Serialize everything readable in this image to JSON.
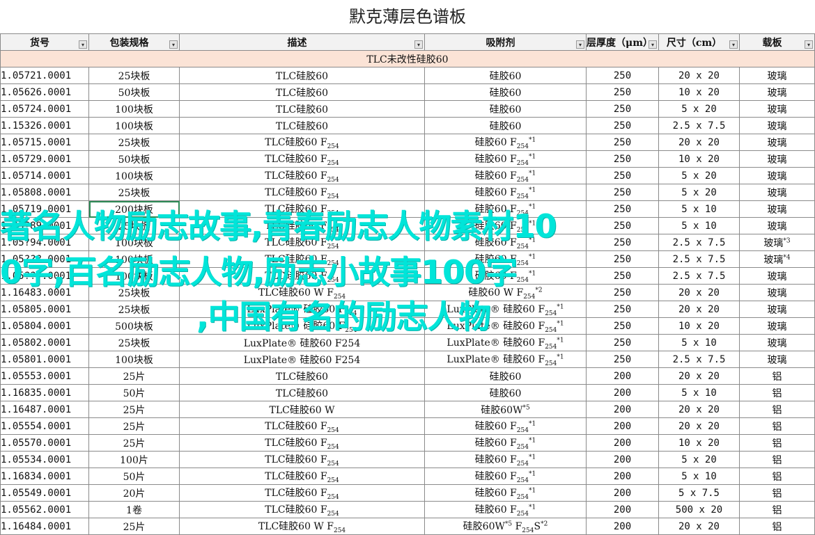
{
  "title": "默克薄层色谱板",
  "headers": [
    "货号",
    "包装规格",
    "描述",
    "吸附剂",
    "层厚度（μm）",
    "尺寸（cm）",
    "载板"
  ],
  "section_label": "TLC未改性硅胶60",
  "rows": [
    {
      "id": "1.05721.0001",
      "pack": "25块板",
      "desc": "TLC硅胶60",
      "ads": "硅胶60",
      "thick": "250",
      "size": "20 x 20",
      "plate": "玻璃"
    },
    {
      "id": "1.05626.0001",
      "pack": "50块板",
      "desc": "TLC硅胶60",
      "ads": "硅胶60",
      "thick": "250",
      "size": "10 x 20",
      "plate": "玻璃"
    },
    {
      "id": "1.05724.0001",
      "pack": "100块板",
      "desc": "TLC硅胶60",
      "ads": "硅胶60",
      "thick": "250",
      "size": "5 x 20",
      "plate": "玻璃"
    },
    {
      "id": "1.15326.0001",
      "pack": "100块板",
      "desc": "TLC硅胶60",
      "ads": "硅胶60",
      "thick": "250",
      "size": "2.5 x 7.5",
      "plate": "玻璃"
    },
    {
      "id": "1.05715.0001",
      "pack": "25块板",
      "desc": "TLC硅胶60 F",
      "desc_sub": "254",
      "ads": "硅胶60 F",
      "ads_sub": "254",
      "ads_sup": "*1",
      "thick": "250",
      "size": "20 x 20",
      "plate": "玻璃"
    },
    {
      "id": "1.05729.0001",
      "pack": "50块板",
      "desc": "TLC硅胶60 F",
      "desc_sub": "254",
      "ads": "硅胶60 F",
      "ads_sub": "254",
      "ads_sup": "*1",
      "thick": "250",
      "size": "10 x 20",
      "plate": "玻璃"
    },
    {
      "id": "1.05714.0001",
      "pack": "100块板",
      "desc": "TLC硅胶60 F",
      "desc_sub": "254",
      "ads": "硅胶60 F",
      "ads_sub": "254",
      "ads_sup": "*1",
      "thick": "250",
      "size": "5 x 20",
      "plate": "玻璃"
    },
    {
      "id": "1.05808.0001",
      "pack": "25块板",
      "desc": "TLC硅胶60 F",
      "desc_sub": "254",
      "ads": "硅胶60 F",
      "ads_sub": "254",
      "ads_sup": "*1",
      "thick": "250",
      "size": "5 x 20",
      "plate": "玻璃"
    },
    {
      "id": "1.05719.0001",
      "pack": "200块板",
      "desc": "TLC硅胶60 F",
      "desc_sub": "254",
      "ads": "硅胶60 F",
      "ads_sub": "254",
      "ads_sup": "*1",
      "thick": "250",
      "size": "5 x 10",
      "plate": "玻璃"
    },
    {
      "id": "1.05?89.0001",
      "pack": "25块板",
      "desc": "TLC硅胶60 F",
      "desc_sub": "254",
      "ads": "硅胶60 F",
      "ads_sub": "254",
      "ads_sup": "*1",
      "thick": "250",
      "size": "5 x 10",
      "plate": "玻璃"
    },
    {
      "id": "1.05?94.0001",
      "pack": "100块板",
      "desc": "TLC硅胶60 F",
      "desc_sub": "254",
      "ads": "硅胶60 F",
      "ads_sub": "254",
      "ads_sup": "*1",
      "thick": "250",
      "size": "2.5 x 7.5",
      "plate": "玻璃",
      "plate_sup": "*3"
    },
    {
      "id": "1.05???.0001",
      "pack": "100块板",
      "desc": "TLC硅胶60 F",
      "desc_sub": "254",
      "ads": "硅胶60 F",
      "ads_sub": "254",
      "ads_sup": "*1",
      "thick": "250",
      "size": "2.5 x 7.5",
      "plate": "玻璃",
      "plate_sup": "*4"
    },
    {
      "id": "1.05???.0001",
      "pack": "100块板",
      "desc": "TLC硅胶60 F",
      "desc_sub": "254",
      "ads": "硅胶60 F",
      "ads_sub": "254",
      "ads_sup": "*1",
      "thick": "250",
      "size": "2.5 x 7.5",
      "plate": "玻璃"
    },
    {
      "id": "1.16483.0001",
      "pack": "25块板",
      "desc": "TLC硅胶60 W F",
      "desc_sub": "254",
      "ads": "硅胶60 W F",
      "ads_sub": "254",
      "ads_sup": "*2",
      "thick": "250",
      "size": "20 x 20",
      "plate": "玻璃"
    },
    {
      "id": "1.05805.0001",
      "pack": "25块板",
      "desc": "LuxPlate® 硅胶60 F",
      "desc_sub": "254",
      "ads": "LuxPlate® 硅胶60 F",
      "ads_sub": "254",
      "ads_sup": "*1",
      "thick": "250",
      "size": "20 x 20",
      "plate": "玻璃"
    },
    {
      "id": "1.05804.0001",
      "pack": "500块板",
      "desc": "LuxPlate® 硅胶60 F",
      "desc_sub": "254",
      "ads": "LuxPlate® 硅胶60 F",
      "ads_sub": "254",
      "ads_sup": "*1",
      "thick": "250",
      "size": "10 x 20",
      "plate": "玻璃"
    },
    {
      "id": "1.05802.0001",
      "pack": "25块板",
      "desc": "LuxPlate® 硅胶60 F254",
      "ads": "LuxPlate® 硅胶60 F",
      "ads_sub": "254",
      "ads_sup": "*1",
      "thick": "250",
      "size": "5 x 10",
      "plate": "玻璃"
    },
    {
      "id": "1.05801.0001",
      "pack": "100块板",
      "desc": "LuxPlate® 硅胶60 F254",
      "ads": "LuxPlate® 硅胶60 F",
      "ads_sub": "254",
      "ads_sup": "*1",
      "thick": "250",
      "size": "2.5 x 7.5",
      "plate": "玻璃"
    },
    {
      "id": "1.05553.0001",
      "pack": "25片",
      "desc": "TLC硅胶60",
      "ads": "硅胶60",
      "thick": "200",
      "size": "20 x 20",
      "plate": "铝"
    },
    {
      "id": "1.16835.0001",
      "pack": "50片",
      "desc": "TLC硅胶60",
      "ads": "硅胶60",
      "thick": "200",
      "size": "5 x 10",
      "plate": "铝"
    },
    {
      "id": "1.16487.0001",
      "pack": "25片",
      "desc": "TLC硅胶60 W",
      "ads": "硅胶60W",
      "ads_sup": "*5",
      "thick": "200",
      "size": "20 x 20",
      "plate": "铝"
    },
    {
      "id": "1.05554.0001",
      "pack": "25片",
      "desc": "TLC硅胶60 F",
      "desc_sub": "254",
      "ads": "硅胶60 F",
      "ads_sub": "254",
      "ads_sup": "*1",
      "thick": "200",
      "size": "20 x 20",
      "plate": "铝"
    },
    {
      "id": "1.05570.0001",
      "pack": "25片",
      "desc": "TLC硅胶60 F",
      "desc_sub": "254",
      "ads": "硅胶60 F",
      "ads_sub": "254",
      "ads_sup": "*1",
      "thick": "200",
      "size": "10 x 20",
      "plate": "铝"
    },
    {
      "id": "1.05534.0001",
      "pack": "100片",
      "desc": "TLC硅胶60 F",
      "desc_sub": "254",
      "ads": "硅胶60 F",
      "ads_sub": "254",
      "ads_sup": "*1",
      "thick": "200",
      "size": "5 x 20",
      "plate": "铝"
    },
    {
      "id": "1.16834.0001",
      "pack": "50片",
      "desc": "TLC硅胶60 F",
      "desc_sub": "254",
      "ads": "硅胶60 F",
      "ads_sub": "254",
      "ads_sup": "*1",
      "thick": "200",
      "size": "5 x 10",
      "plate": "铝"
    },
    {
      "id": "1.05549.0001",
      "pack": "20片",
      "desc": "TLC硅胶60 F",
      "desc_sub": "254",
      "ads": "硅胶60 F",
      "ads_sub": "254",
      "ads_sup": "*1",
      "thick": "200",
      "size": "5 x 7.5",
      "plate": "铝"
    },
    {
      "id": "1.05562.0001",
      "pack": "1卷",
      "desc": "TLC硅胶60 F",
      "desc_sub": "254",
      "ads": "硅胶60 F",
      "ads_sub": "254",
      "ads_sup": "*1",
      "thick": "200",
      "size": "500 x 20",
      "plate": "铝"
    },
    {
      "id": "1.16484.0001",
      "pack": "25片",
      "desc": "TLC硅胶60 W F",
      "desc_sub": "254",
      "ads": "硅胶60W",
      "ads_sup": "*5",
      "ads2": " F",
      "ads2_sub": "254",
      "ads2_tail": "S",
      "ads2_sup": "*2",
      "thick": "200",
      "size": "20 x 20",
      "plate": "铝"
    }
  ],
  "overlay": {
    "line1": "著名人物励志故事,青春励志人物素材10",
    "line2": "0字,百名励志人物,励志小故事100字",
    "line3": ",中国有名的励志人物"
  }
}
